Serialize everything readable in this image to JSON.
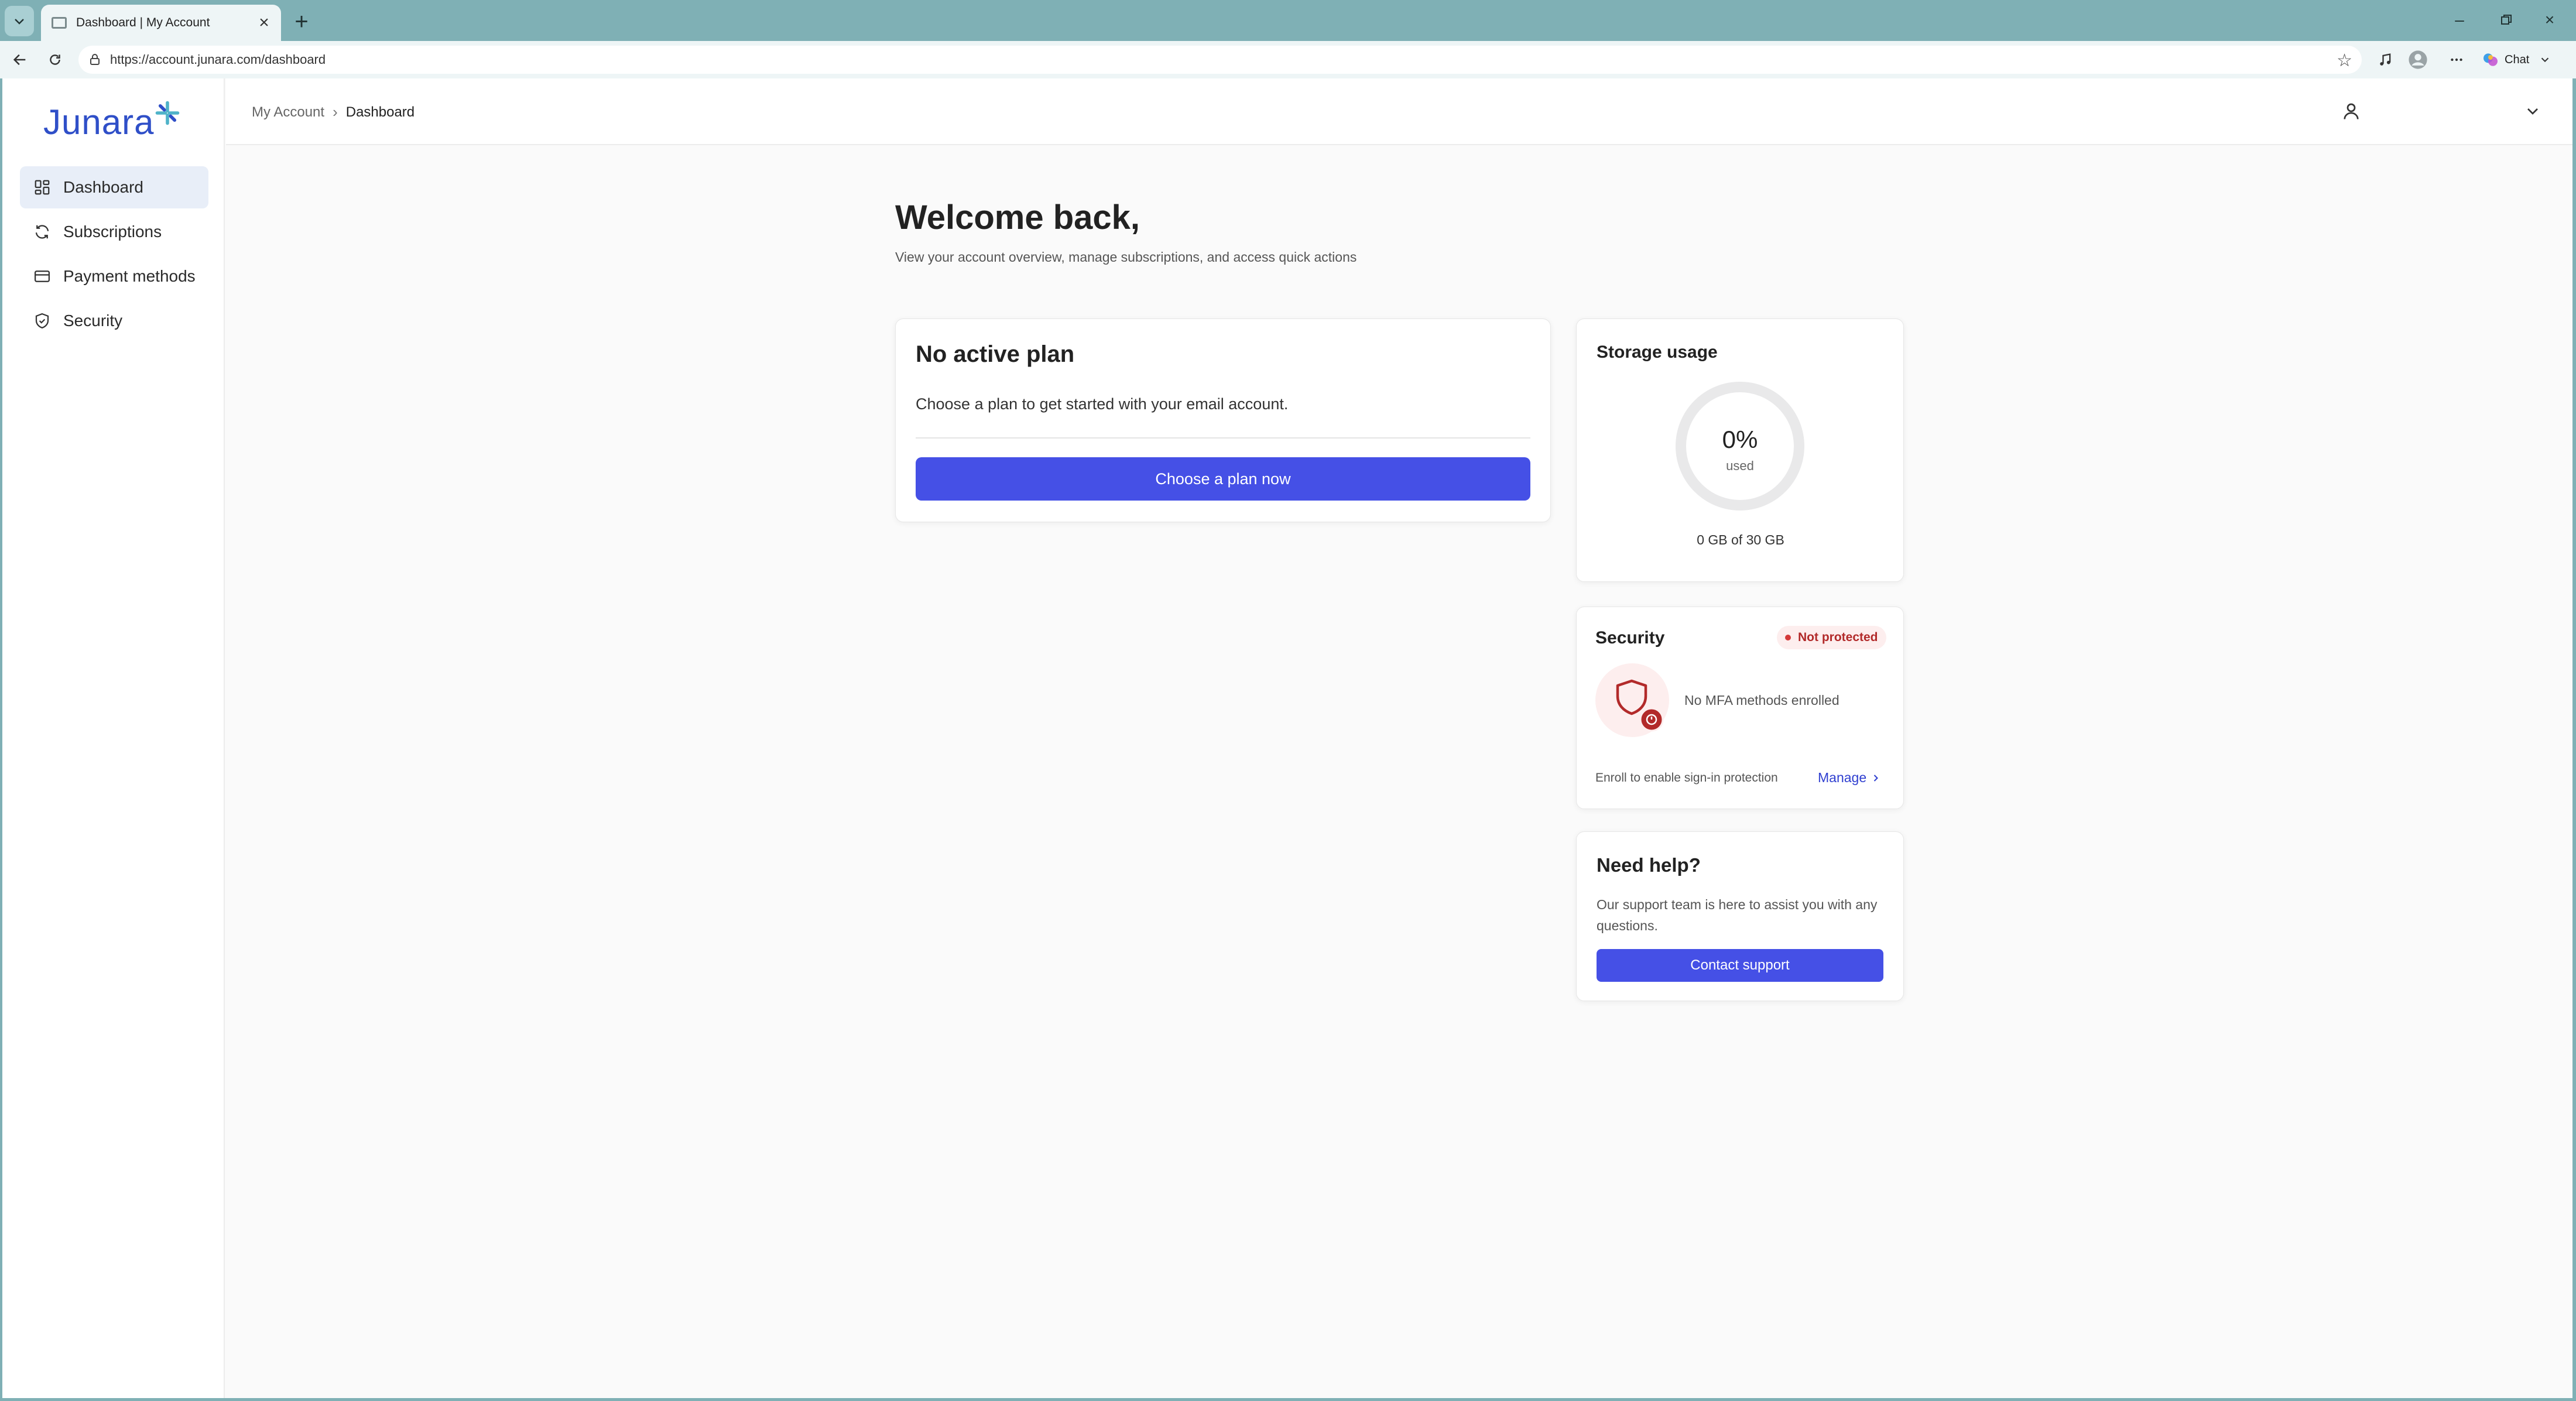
{
  "browser": {
    "tab_title": "Dashboard | My Account",
    "url": "https://account.junara.com/dashboard",
    "chat_label": "Chat"
  },
  "sidebar": {
    "logo_text": "Junara",
    "items": [
      {
        "label": "Dashboard",
        "icon": "grid-icon",
        "active": true
      },
      {
        "label": "Subscriptions",
        "icon": "refresh-icon",
        "active": false
      },
      {
        "label": "Payment methods",
        "icon": "credit-card-icon",
        "active": false
      },
      {
        "label": "Security",
        "icon": "shield-check-icon",
        "active": false
      }
    ]
  },
  "header": {
    "breadcrumb": [
      "My Account",
      "Dashboard"
    ]
  },
  "main": {
    "title": "Welcome back,",
    "subtitle": "View your account overview, manage subscriptions, and access quick actions"
  },
  "plan_card": {
    "title": "No active plan",
    "text": "Choose a plan to get started with your email account.",
    "button_label": "Choose a plan now"
  },
  "storage_card": {
    "title": "Storage usage",
    "percent_label": "0%",
    "used_label": "used",
    "caption": "0 GB of 30 GB",
    "used_fraction": 0
  },
  "security_card": {
    "title": "Security",
    "badge": "Not protected",
    "status": "No MFA methods enrolled",
    "hint": "Enroll to enable sign-in protection",
    "manage_label": "Manage"
  },
  "help_card": {
    "title": "Need help?",
    "text": "Our support team is here to assist you with any questions.",
    "button_label": "Contact support"
  },
  "colors": {
    "accent": "#4550e6",
    "danger": "#b22a2a",
    "brand": "#2f4fc8"
  }
}
